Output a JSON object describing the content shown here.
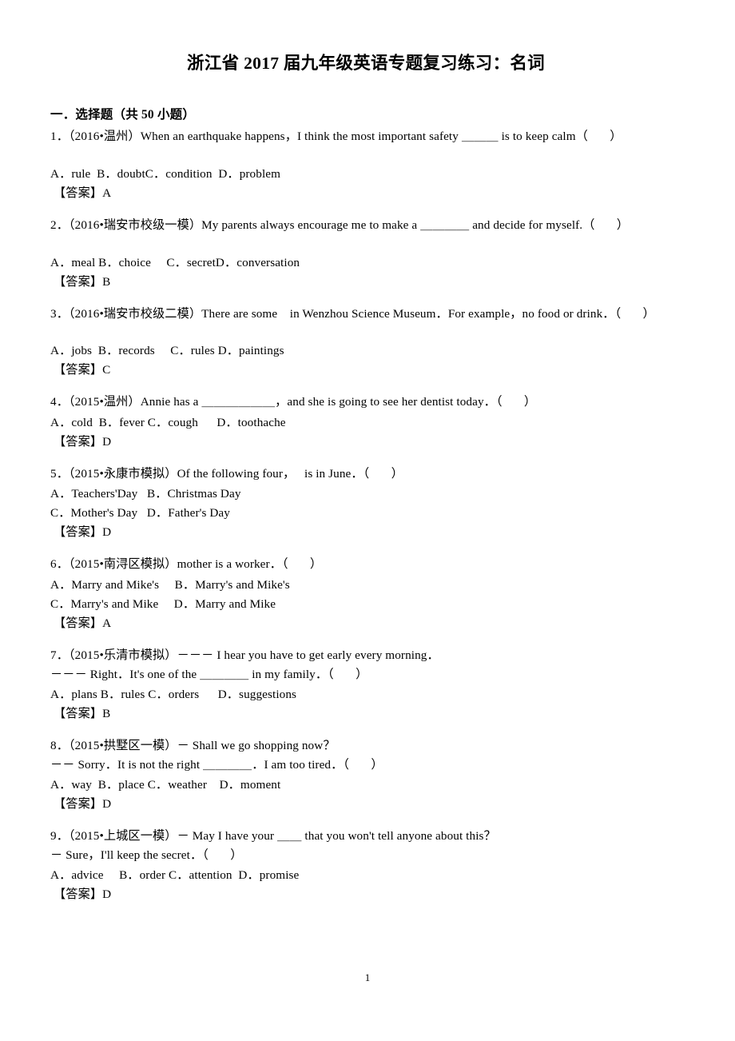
{
  "document": {
    "title": "浙江省 2017 届九年级英语专题复习练习：名词",
    "page_number": "1"
  },
  "section": {
    "heading": "一．选择题（共 50 小题）"
  },
  "questions": [
    {
      "stem": "1．（2016•温州）When an earthquake happens，I think the most important safety ＿＿＿ is to keep calm（       ）",
      "stem_line2": "",
      "extra_gap": true,
      "options": [
        "A．rule  B．doubtC．condition  D．problem"
      ],
      "answer": "【答案】A"
    },
    {
      "stem": "2．（2016•瑞安市校级一模）My parents always encourage me to make a ＿＿＿＿ and decide for myself.（       ）",
      "stem_line2": "",
      "extra_gap": true,
      "options": [
        "A．meal B．choice     C．secretD．conversation"
      ],
      "answer": "【答案】B"
    },
    {
      "stem": "3．（2016•瑞安市校级二模）There are some    in Wenzhou Science Museum．For example，no food or drink．（       ）",
      "stem_line2": "",
      "extra_gap": true,
      "options": [
        "A．jobs  B．records     C．rules D．paintings"
      ],
      "answer": "【答案】C"
    },
    {
      "stem": "4．（2015•温州）Annie has a ＿＿＿＿＿＿，and she is going to see her dentist today．（       ）",
      "stem_line2": "",
      "extra_gap": false,
      "options": [
        "A．cold  B．fever C．cough      D．toothache"
      ],
      "answer": "【答案】D"
    },
    {
      "stem": "5．（2015•永康市模拟）Of the following four，   is in June．（       ）",
      "stem_line2": "",
      "extra_gap": false,
      "options": [
        "A．Teachers'Day   B．Christmas Day",
        "C．Mother's Day   D．Father's Day"
      ],
      "answer": "【答案】D"
    },
    {
      "stem": "6．（2015•南浔区模拟）mother is a worker．（       ）",
      "stem_line2": "",
      "extra_gap": false,
      "options": [
        "A．Marry and Mike's     B．Marry's and Mike's",
        "C．Marry's and Mike     D．Marry and Mike"
      ],
      "answer": "【答案】A"
    },
    {
      "stem": "7．（2015•乐清市模拟）－－－ I hear you have to get early every morning．",
      "stem_line2": "－－－ Right．It's one of the ＿＿＿＿ in my family．（       ）",
      "extra_gap": false,
      "options": [
        "A．plans B．rules C．orders      D．suggestions"
      ],
      "answer": "【答案】B"
    },
    {
      "stem": "8．（2015•拱墅区一模）－ Shall we go shopping now？",
      "stem_line2": "－－ Sorry．It is not the right ＿＿＿＿．I am too tired．（       ）",
      "extra_gap": false,
      "options": [
        "A．way  B．place C．weather    D．moment"
      ],
      "answer": "【答案】D"
    },
    {
      "stem": "9．（2015•上城区一模）－ May I have your ＿＿ that you won't tell anyone about this？",
      "stem_line2": "－ Sure，I'll keep the secret．（       ）",
      "extra_gap": false,
      "options": [
        "A．advice     B．order C．attention  D．promise"
      ],
      "answer": "【答案】D"
    }
  ]
}
